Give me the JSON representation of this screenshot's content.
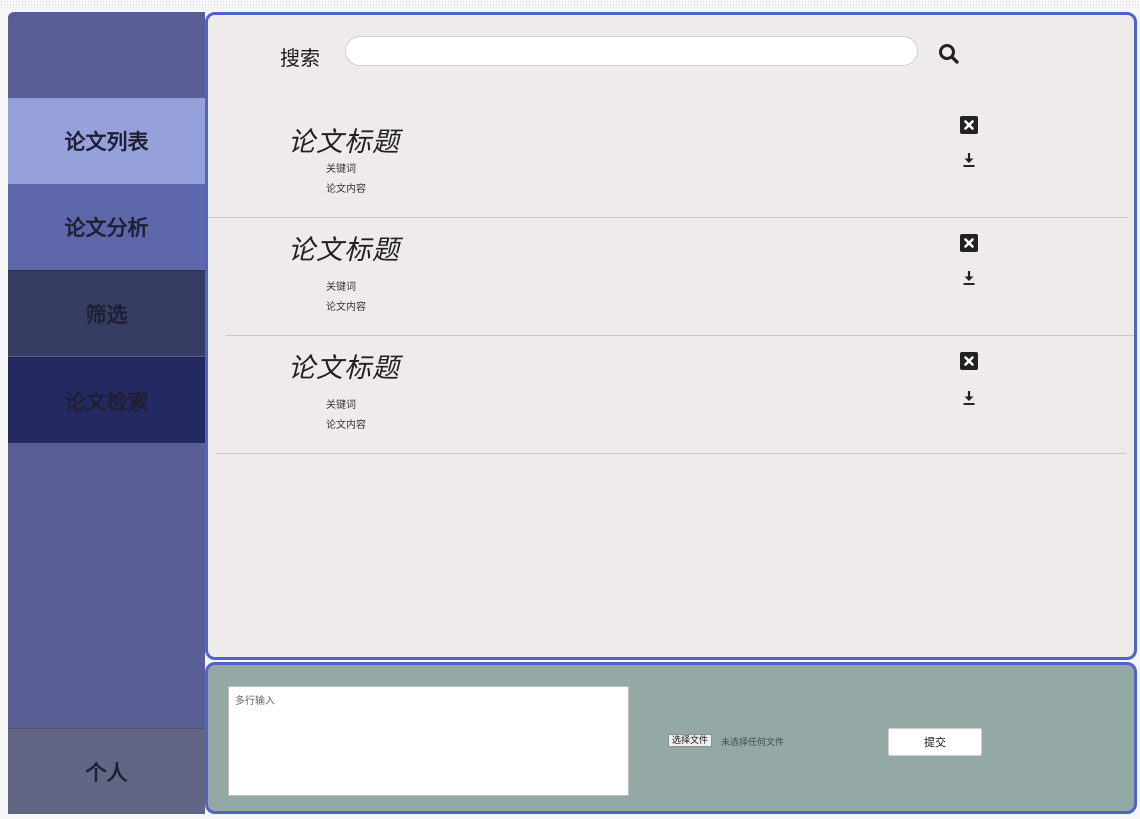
{
  "sidebar": {
    "items": [
      {
        "label": "论文列表"
      },
      {
        "label": "论文分析"
      },
      {
        "label": "筛选"
      },
      {
        "label": "论文检索"
      }
    ],
    "personal": {
      "label": "个人"
    }
  },
  "search": {
    "label": "搜索",
    "value": "",
    "icon": "search-icon"
  },
  "papers": [
    {
      "title": "论文标题",
      "keywords": "关键词",
      "content": "论文内容",
      "delete_icon": "close-square-icon",
      "download_icon": "download-icon"
    },
    {
      "title": "论文标题",
      "keywords": "关键词",
      "content": "论文内容",
      "delete_icon": "close-square-icon",
      "download_icon": "download-icon"
    },
    {
      "title": "论文标题",
      "keywords": "关键词",
      "content": "论文内容",
      "delete_icon": "close-square-icon",
      "download_icon": "download-icon"
    }
  ],
  "upload": {
    "textarea_placeholder": "多行输入",
    "file_button_label": "选择文件",
    "file_status": "未选择任何文件",
    "submit_label": "提交"
  },
  "colors": {
    "sidebar_bg": "#595e94",
    "active_item": "#96a0da",
    "main_border": "#4f63c9",
    "main_bg": "#efebeb",
    "bottom_bg": "#94a8a6"
  }
}
